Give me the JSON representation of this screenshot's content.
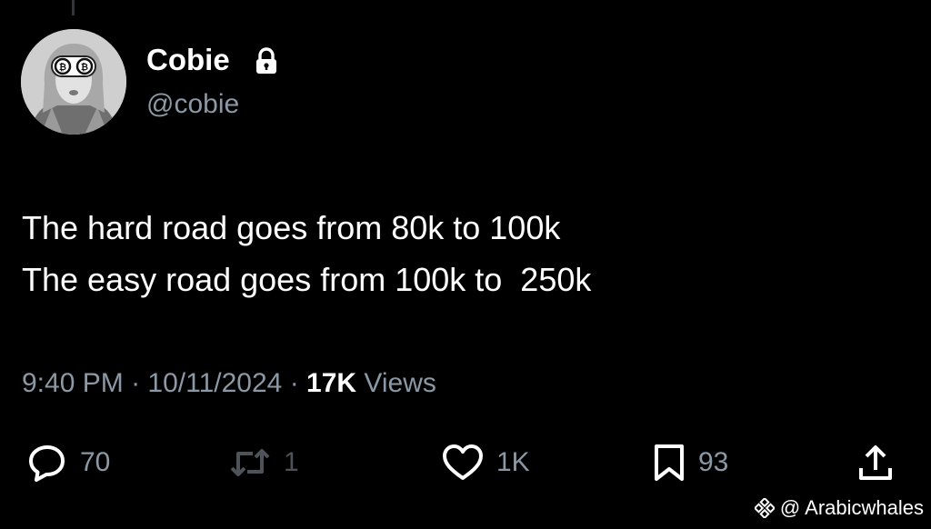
{
  "tweet": {
    "author": {
      "name": "Cobie",
      "handle": "@cobie",
      "avatar_icon": "avatar-bitcoin-glasses",
      "verified_icon": "lock-icon"
    },
    "text_lines": [
      "The hard road goes from 80k to 100k",
      "The easy road goes from 100k to  250k"
    ],
    "time": "9:40 PM",
    "date": "10/11/2024",
    "separator": "·",
    "views_count": "17K",
    "views_label": "Views",
    "actions": {
      "replies": "70",
      "retweets": "1",
      "likes": "1K",
      "bookmarks": "93"
    }
  },
  "watermark": {
    "text": "@ Arabicwhales",
    "icon": "binance-icon"
  },
  "colors": {
    "background": "#000000",
    "text_primary": "#ffffff",
    "text_secondary": "#8b98a5"
  }
}
